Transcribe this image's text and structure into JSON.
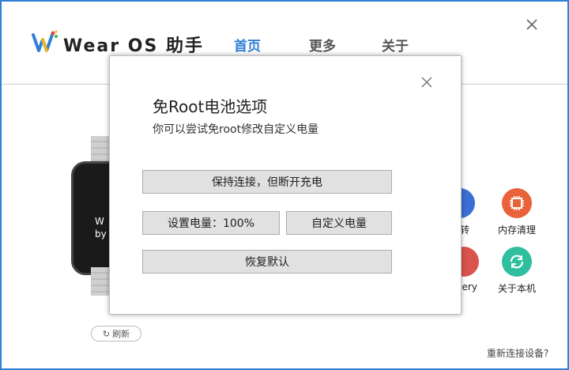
{
  "header": {
    "app_title": "Wear OS 助手",
    "tabs": [
      {
        "label": "首页",
        "active": true
      },
      {
        "label": "更多",
        "active": false
      },
      {
        "label": "关于",
        "active": false
      }
    ],
    "accent_color": "#2f7fd6"
  },
  "main": {
    "watch_text_line1": "W",
    "watch_text_line2": "by",
    "refresh_label": "刷新",
    "tools": [
      {
        "label": "跳转",
        "icon": "arrow-icon",
        "color": "#3b6fd4"
      },
      {
        "label": "内存清理",
        "icon": "chip-icon",
        "color": "#e8633a"
      },
      {
        "label": "overy",
        "icon": "recovery-icon",
        "color": "#d9534f"
      },
      {
        "label": "关于本机",
        "icon": "refresh-cycle-icon",
        "color": "#2fbf9f"
      }
    ],
    "reconnect_label": "重新连接设备?"
  },
  "modal": {
    "title": "免Root电池选项",
    "subtitle": "你可以尝试免root修改自定义电量",
    "buttons": {
      "keep_connected": "保持连接，但断开充电",
      "set_level": "设置电量：100%",
      "custom_level": "自定义电量",
      "restore_default": "恢复默认"
    }
  }
}
